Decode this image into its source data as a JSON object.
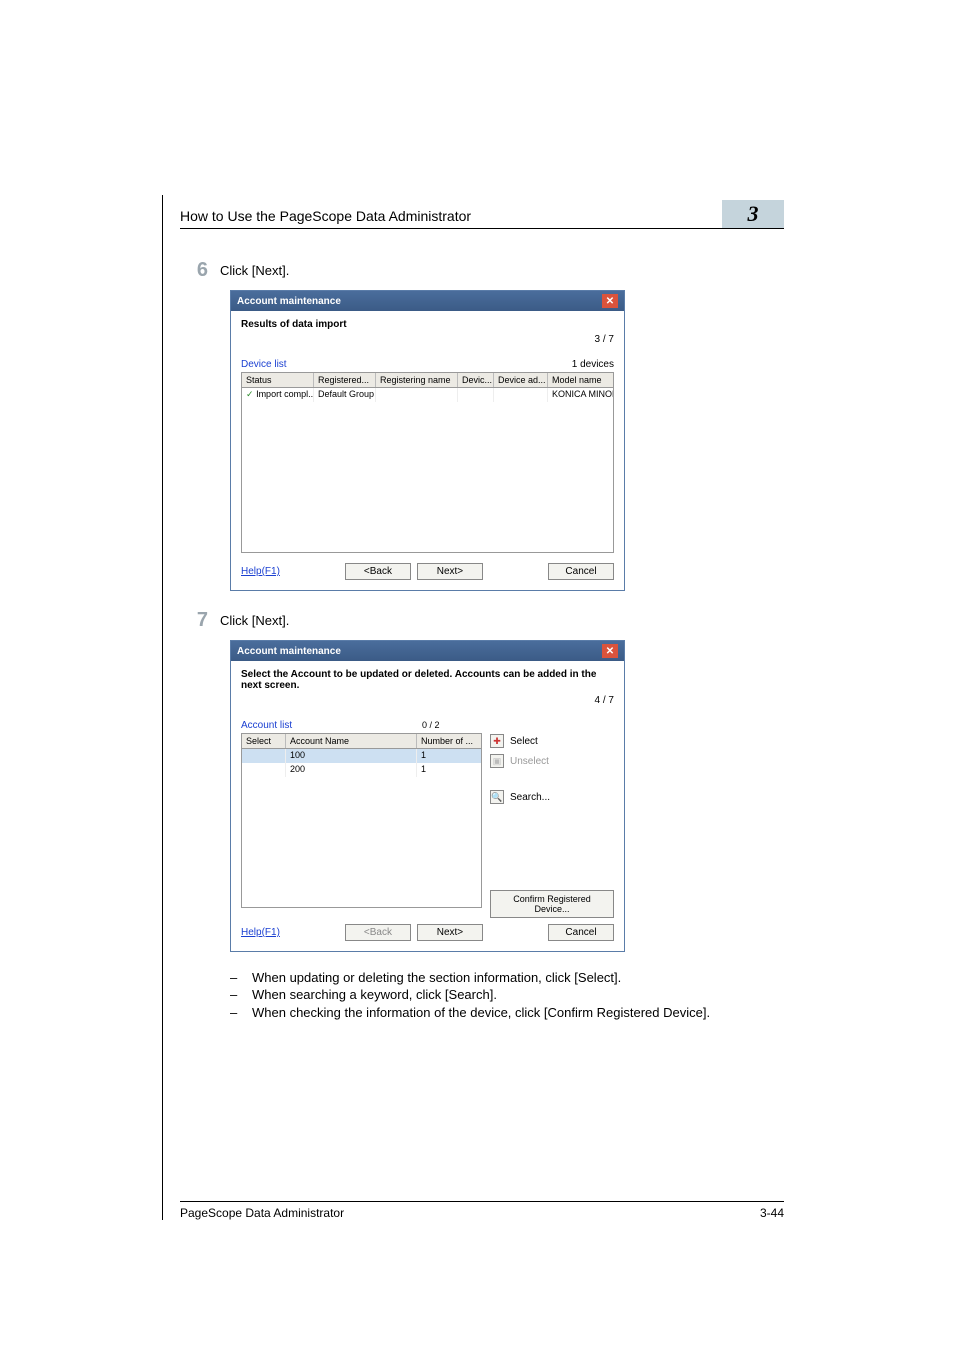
{
  "header": {
    "title": "How to Use the PageScope Data Administrator",
    "chapter": "3"
  },
  "step6": {
    "num": "6",
    "instruction": "Click [Next].",
    "dialog": {
      "title": "Account maintenance",
      "heading": "Results of data import",
      "page_counter": "3 / 7",
      "list_label": "Device list",
      "device_count": "1 devices",
      "columns": {
        "status": "Status",
        "registered": "Registered...",
        "registering": "Registering name",
        "devic": "Devic...",
        "device_ad": "Device ad...",
        "model": "Model name"
      },
      "row": {
        "status": "Import compl...",
        "registered": "Default Group",
        "registering": "",
        "devic": "",
        "device_ad": "",
        "model": "KONICA MINOLTA bizh..."
      },
      "icon_label": "✓",
      "help": "Help(F1)",
      "back": "<Back",
      "next": "Next>",
      "cancel": "Cancel"
    }
  },
  "step7": {
    "num": "7",
    "instruction": "Click [Next].",
    "dialog": {
      "title": "Account maintenance",
      "heading": "Select the Account to be updated or deleted. Accounts can be added in the next screen.",
      "page_counter": "4 / 7",
      "list_label": "Account list",
      "list_count": "0 / 2",
      "columns": {
        "select": "Select",
        "account": "Account Name",
        "number": "Number of ..."
      },
      "rows": [
        {
          "select": "",
          "account": "100",
          "number": "1"
        },
        {
          "select": "",
          "account": "200",
          "number": "1"
        }
      ],
      "side": {
        "select": "Select",
        "select_icon": "✚",
        "unselect": "Unselect",
        "unselect_icon": "▣",
        "search": "Search...",
        "search_icon": "🔍",
        "confirm": "Confirm Registered Device..."
      },
      "help": "Help(F1)",
      "back": "<Back",
      "next": "Next>",
      "cancel": "Cancel"
    }
  },
  "bullets": {
    "b1": "When updating or deleting the section information, click [Select].",
    "b2": "When searching a keyword, click [Search].",
    "b3": "When checking the information of the device, click [Confirm Registered Device]."
  },
  "footer": {
    "left": "PageScope Data Administrator",
    "right": "3-44"
  }
}
